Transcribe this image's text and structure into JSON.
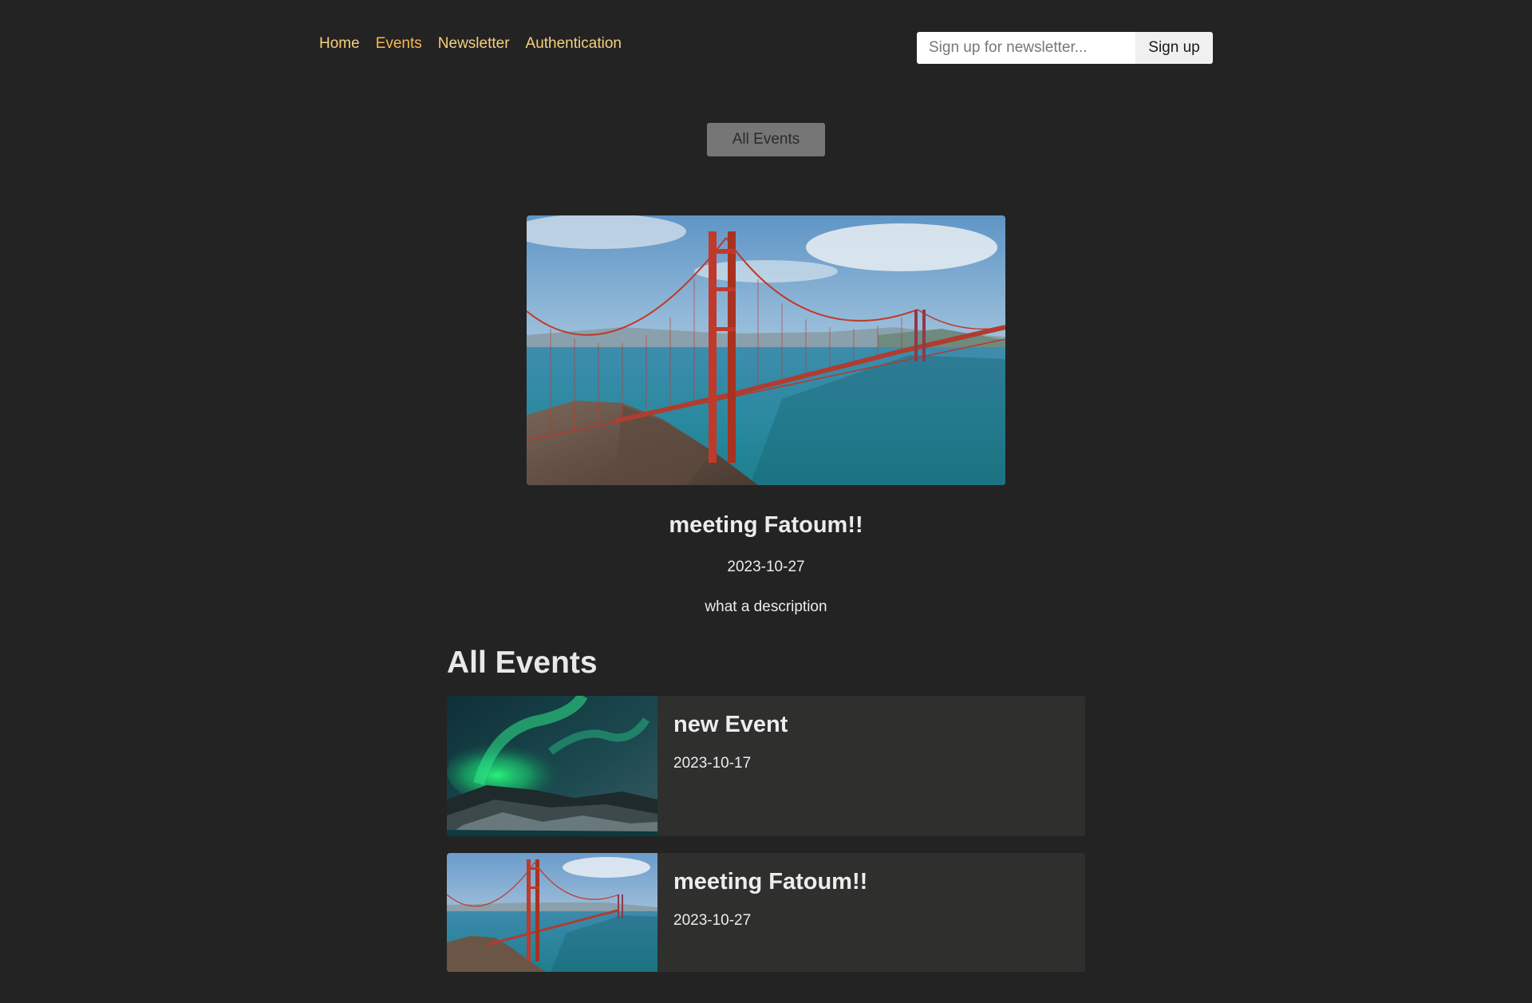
{
  "nav": {
    "items": [
      {
        "label": "Home",
        "active": false
      },
      {
        "label": "Events",
        "active": true
      },
      {
        "label": "Newsletter",
        "active": false
      },
      {
        "label": "Authentication",
        "active": false
      }
    ]
  },
  "newsletter": {
    "placeholder": "Sign up for newsletter...",
    "value": "",
    "button_label": "Sign up"
  },
  "all_events_button": "All Events",
  "featured": {
    "title": "meeting Fatoum!!",
    "date": "2023-10-27",
    "description": "what a description",
    "image_icon": "golden-gate-bridge-image"
  },
  "list": {
    "heading": "All Events",
    "events": [
      {
        "title": "new Event",
        "date": "2023-10-17",
        "image_icon": "aurora-image"
      },
      {
        "title": "meeting Fatoum!!",
        "date": "2023-10-27",
        "image_icon": "golden-gate-bridge-image"
      }
    ]
  },
  "colors": {
    "background": "#232323",
    "nav_link": "#f6cf7d",
    "nav_active": "#f9b64f",
    "card": "#2f2f2e",
    "button": "#777676"
  }
}
